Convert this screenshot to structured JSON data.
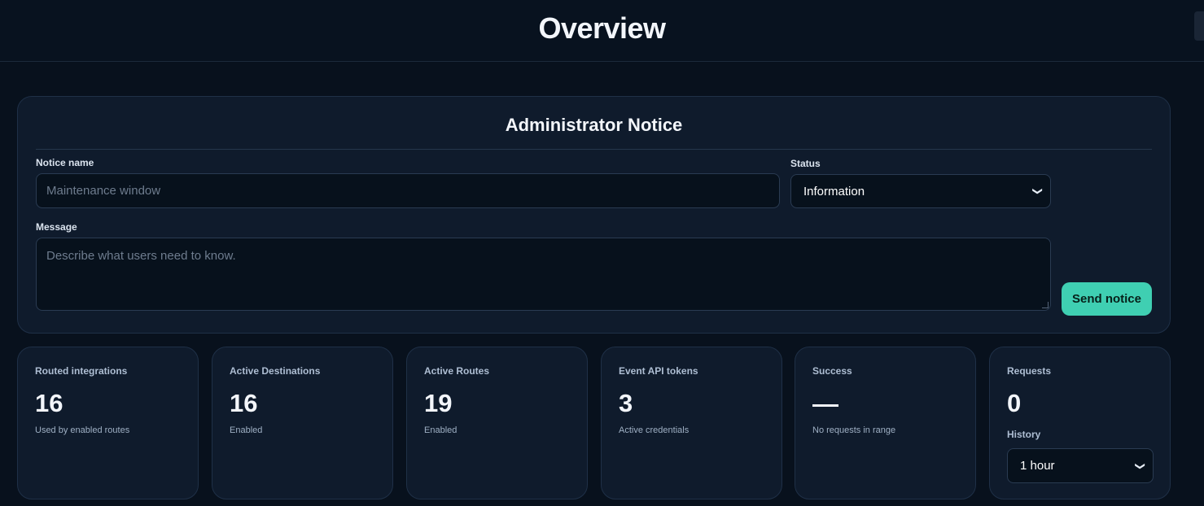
{
  "header": {
    "title": "Overview"
  },
  "notice": {
    "title": "Administrator Notice",
    "name_label": "Notice name",
    "name_placeholder": "Maintenance window",
    "status_label": "Status",
    "status_value": "Information",
    "message_label": "Message",
    "message_placeholder": "Describe what users need to know.",
    "send_label": "Send notice"
  },
  "stats": [
    {
      "label": "Routed integrations",
      "value": "16",
      "sub": "Used by enabled routes"
    },
    {
      "label": "Active Destinations",
      "value": "16",
      "sub": "Enabled"
    },
    {
      "label": "Active Routes",
      "value": "19",
      "sub": "Enabled"
    },
    {
      "label": "Event API tokens",
      "value": "3",
      "sub": "Active credentials"
    },
    {
      "label": "Success",
      "value": "",
      "sub": "No requests in range"
    },
    {
      "label": "Requests",
      "value": "0",
      "history_label": "History",
      "history_value": "1 hour"
    }
  ],
  "colors": {
    "accent": "#3fcfb2",
    "background": "#08111d",
    "card": "#0f1b2c"
  }
}
